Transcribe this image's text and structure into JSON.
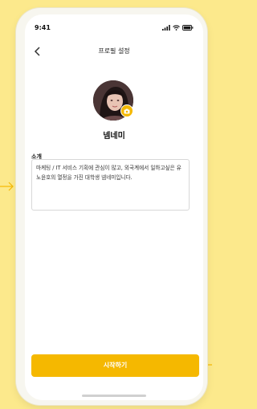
{
  "status_bar": {
    "time": "9:41"
  },
  "header": {
    "title": "프로필 설정",
    "back_icon": "chevron-left-icon"
  },
  "profile": {
    "nickname": "넴네미",
    "camera_icon": "camera-icon"
  },
  "intro": {
    "label": "소개",
    "text": "마케팅 / IT 서비스 기획에 관심이 많고, 외국계에서 일하고싶은 유노윤호의 열정을 가진 대학생 넴네미입니다."
  },
  "actions": {
    "start_label": "시작하기"
  },
  "colors": {
    "accent": "#f5b800",
    "background": "#fce98c"
  }
}
